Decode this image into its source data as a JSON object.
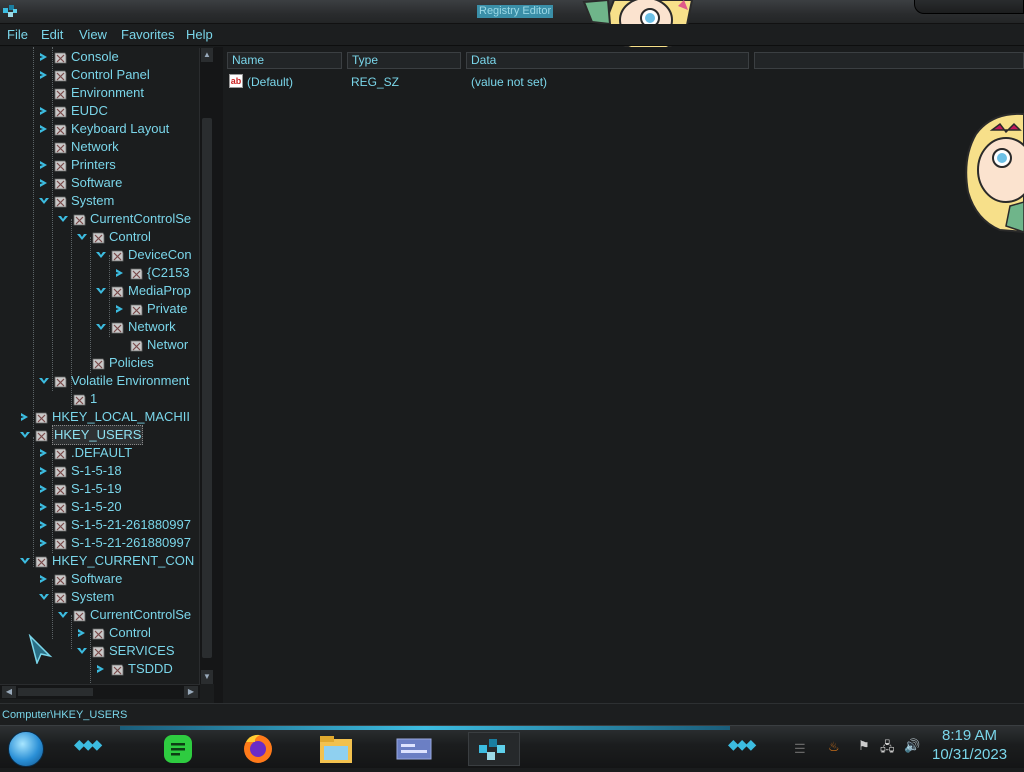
{
  "window": {
    "title": "Registry Editor"
  },
  "menu": [
    "File",
    "Edit",
    "View",
    "Favorites",
    "Help"
  ],
  "tree": {
    "rows": [
      {
        "label": "Console",
        "depth": 2,
        "state": "collapsed"
      },
      {
        "label": "Control Panel",
        "depth": 2,
        "state": "collapsed"
      },
      {
        "label": "Environment",
        "depth": 2,
        "state": "leaf"
      },
      {
        "label": "EUDC",
        "depth": 2,
        "state": "collapsed"
      },
      {
        "label": "Keyboard Layout",
        "depth": 2,
        "state": "collapsed"
      },
      {
        "label": "Network",
        "depth": 2,
        "state": "leaf"
      },
      {
        "label": "Printers",
        "depth": 2,
        "state": "collapsed"
      },
      {
        "label": "Software",
        "depth": 2,
        "state": "collapsed"
      },
      {
        "label": "System",
        "depth": 2,
        "state": "expanded"
      },
      {
        "label": "CurrentControlSe",
        "depth": 3,
        "state": "expanded"
      },
      {
        "label": "Control",
        "depth": 4,
        "state": "expanded"
      },
      {
        "label": "DeviceCon",
        "depth": 5,
        "state": "expanded"
      },
      {
        "label": "{C2153",
        "depth": 6,
        "state": "collapsed"
      },
      {
        "label": "MediaProp",
        "depth": 5,
        "state": "expanded"
      },
      {
        "label": "Private",
        "depth": 6,
        "state": "collapsed"
      },
      {
        "label": "Network",
        "depth": 5,
        "state": "expanded"
      },
      {
        "label": "Networ",
        "depth": 6,
        "state": "leaf"
      },
      {
        "label": "Policies",
        "depth": 4,
        "state": "leaf"
      },
      {
        "label": "Volatile Environment",
        "depth": 2,
        "state": "expanded"
      },
      {
        "label": "1",
        "depth": 3,
        "state": "leaf"
      },
      {
        "label": "HKEY_LOCAL_MACHII",
        "depth": 1,
        "state": "collapsed"
      },
      {
        "label": "HKEY_USERS",
        "depth": 1,
        "state": "expanded",
        "selected": true
      },
      {
        "label": ".DEFAULT",
        "depth": 2,
        "state": "collapsed"
      },
      {
        "label": "S-1-5-18",
        "depth": 2,
        "state": "collapsed"
      },
      {
        "label": "S-1-5-19",
        "depth": 2,
        "state": "collapsed"
      },
      {
        "label": "S-1-5-20",
        "depth": 2,
        "state": "collapsed"
      },
      {
        "label": "S-1-5-21-261880997",
        "depth": 2,
        "state": "collapsed"
      },
      {
        "label": "S-1-5-21-261880997",
        "depth": 2,
        "state": "collapsed"
      },
      {
        "label": "HKEY_CURRENT_CON",
        "depth": 1,
        "state": "expanded"
      },
      {
        "label": "Software",
        "depth": 2,
        "state": "collapsed"
      },
      {
        "label": "System",
        "depth": 2,
        "state": "expanded"
      },
      {
        "label": "CurrentControlSe",
        "depth": 3,
        "state": "expanded"
      },
      {
        "label": "Control",
        "depth": 4,
        "state": "collapsed"
      },
      {
        "label": "SERVICES",
        "depth": 4,
        "state": "expanded"
      },
      {
        "label": "TSDDD",
        "depth": 5,
        "state": "collapsed"
      }
    ]
  },
  "list": {
    "columns": [
      "Name",
      "Type",
      "Data"
    ],
    "rows": [
      {
        "name": "(Default)",
        "type": "REG_SZ",
        "data": "(value not set)",
        "icon": "string-value-icon"
      }
    ]
  },
  "status": {
    "path": "Computer\\HKEY_USERS"
  },
  "taskbar": {
    "apps": [
      {
        "name": "notes-app-icon",
        "color": "#2ecc40"
      },
      {
        "name": "firefox-icon",
        "color": "#ff7a1a"
      },
      {
        "name": "file-explorer-icon",
        "color": "#f2c14e"
      },
      {
        "name": "window-switcher-icon",
        "color": "#6b7fc4"
      },
      {
        "name": "registry-editor-icon",
        "color": "#3cbce0"
      }
    ],
    "time": "8:19 AM",
    "date": "10/31/2023"
  },
  "colors": {
    "accent": "#7ad6ea",
    "background": "#1a1c1d",
    "folder": "#c9c9c9"
  }
}
